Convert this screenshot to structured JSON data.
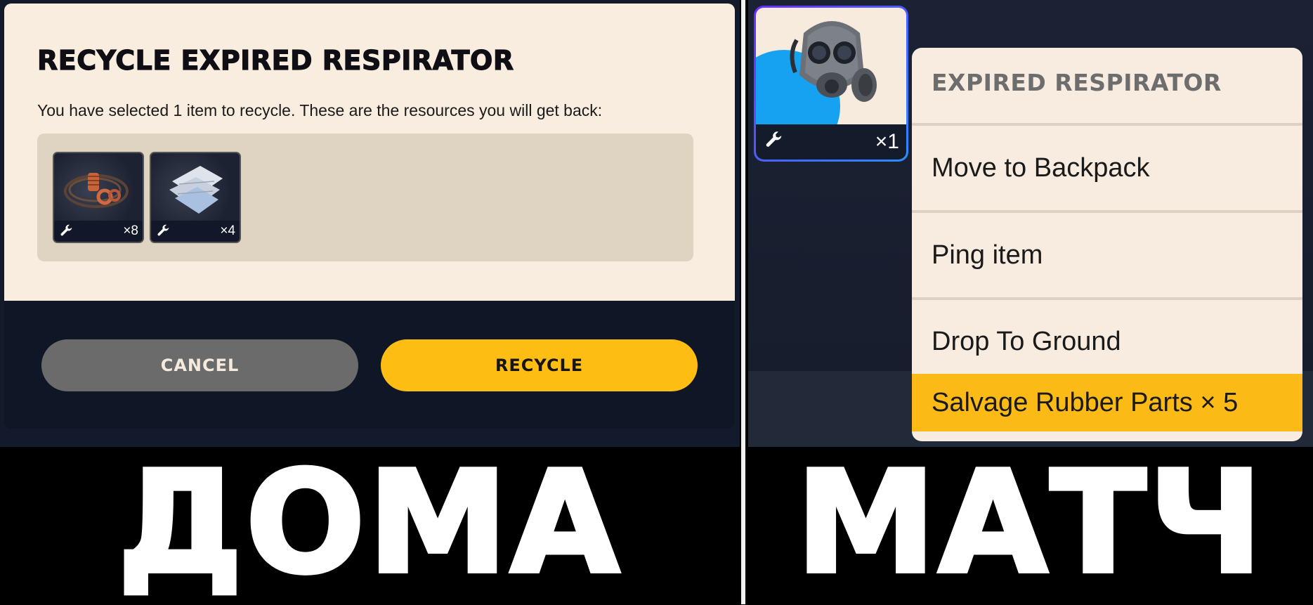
{
  "recycle_dialog": {
    "title": "RECYCLE EXPIRED RESPIRATOR",
    "description": "You have selected 1 item to recycle. These are the resources you will get back:",
    "resources": [
      {
        "icon": "copper-wire-icon",
        "quantity": "×8"
      },
      {
        "icon": "fabric-icon",
        "quantity": "×4"
      }
    ],
    "cancel_label": "CANCEL",
    "recycle_label": "RECYCLE"
  },
  "item_card": {
    "icon": "respirator-icon",
    "quantity": "×1"
  },
  "context_menu": {
    "header": "EXPIRED RESPIRATOR",
    "items": [
      {
        "label": "Move to Backpack"
      },
      {
        "label": "Ping item"
      },
      {
        "label": "Drop To Ground"
      },
      {
        "label": "Salvage Rubber Parts × 5"
      }
    ]
  },
  "captions": {
    "left": "ДОМА",
    "right": "МАТЧ"
  },
  "colors": {
    "accent_yellow": "#fdbd13",
    "dialog_bg": "#f9ede0",
    "dark_navy": "#121a2c"
  }
}
